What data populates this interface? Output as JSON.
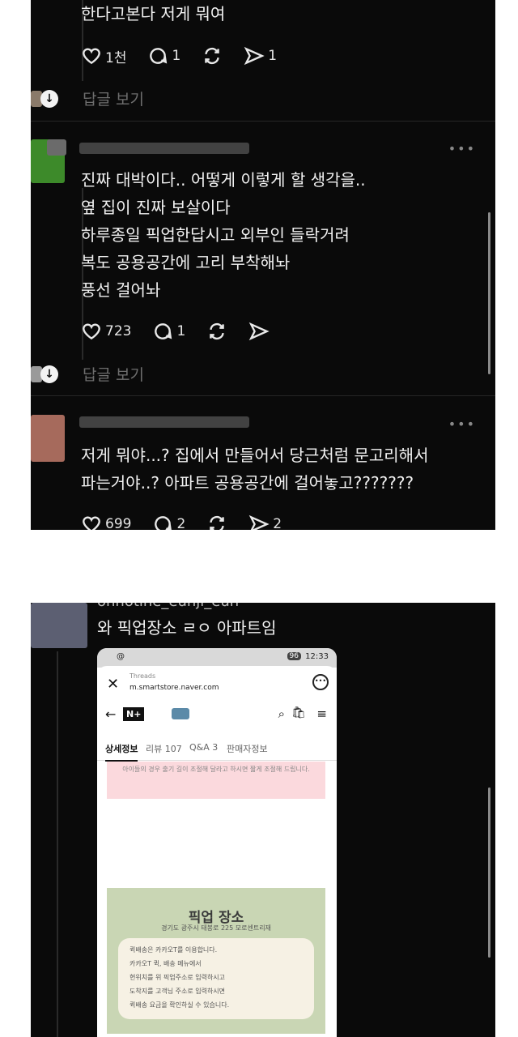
{
  "comments": [
    {
      "text_lines": [
        "한다고본다 저게 뭐여"
      ],
      "likes": "1천",
      "replies": "1",
      "shares": "1",
      "reply_link": "답글 보기"
    },
    {
      "text_lines": [
        "진짜 대박이다.. 어떻게 이렇게 할 생각을..",
        "옆 집이 진짜 보살이다",
        "하루종일 픽업한답시고 외부인 들락거려",
        "복도 공용공간에 고리 부착해놔",
        "풍선 걸어놔"
      ],
      "likes": "723",
      "replies": "1",
      "reply_link": "답글 보기"
    },
    {
      "text_lines": [
        "저게 뭐야...? 집에서 만들어서 당근처럼 문고리해서",
        "파는거야..? 아파트 공용공간에 걸어놓고???????"
      ],
      "likes": "699",
      "replies": "2",
      "shares": "2"
    }
  ],
  "post2": {
    "username_partial": "onnotine_eunji_eun",
    "text": "와 픽업장소 ㄹㅇ 아파트임"
  },
  "phone": {
    "status_time": "12:33",
    "status_battery": "96",
    "app_name": "Threads",
    "url": "m.smartstore.naver.com",
    "brand": "N+",
    "tabs": [
      "상세정보",
      "리뷰 107",
      "Q&A 3",
      "판매자정보"
    ],
    "pink_note": "아이들의 경우 출기 길이 조절해 달라고 하시면 짧게 조절해 드립니다.",
    "pickup_title": "픽업 장소",
    "pickup_address": "경기도 광주시 태봉로 225 모로센트리재",
    "pickup_lines": [
      "퀵배송은 카카오T를 이용합니다.",
      "카카오T 퀵, 배송 메뉴에서",
      "현위치를 위 픽업주소로 입력하시고",
      "도착지를 고객님 주소로 입력하시면",
      "퀵배송 요금을 확인하실 수 있습니다."
    ]
  },
  "colors": {
    "panel_bg": "#0a0a0a",
    "pink": "#fbd9dd",
    "green": "#c9d6b4"
  }
}
